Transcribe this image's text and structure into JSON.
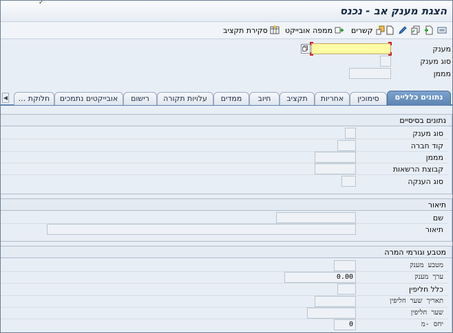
{
  "window": {
    "title": "הצגת מענק אב  - נכנס"
  },
  "toolbar": {
    "budget_closure": "סקירת תקציב",
    "object_map": "ממפה אובייקט",
    "relations": "קשרים"
  },
  "header": {
    "grant_label": "מענק",
    "grant_value": "",
    "grant_type_label": "סוג מענק",
    "grant_type_value": "",
    "sponsor_label": "מממן",
    "sponsor_value": ""
  },
  "tabs": [
    {
      "label": "נתונים כלליים",
      "active": true
    },
    {
      "label": "סימוכין",
      "active": false
    },
    {
      "label": "אחריות",
      "active": false
    },
    {
      "label": "תקציב",
      "active": false
    },
    {
      "label": "חיוב",
      "active": false
    },
    {
      "label": "ממדים",
      "active": false
    },
    {
      "label": "עלויות תקורה",
      "active": false
    },
    {
      "label": "רישום",
      "active": false
    },
    {
      "label": "אובייקטים נתמכים",
      "active": false
    },
    {
      "label": "חלוקת ...",
      "active": false
    }
  ],
  "basic_data": {
    "title": "נתונים בסיסיים",
    "grant_type_label": "סוג מענק",
    "grant_type_value": "",
    "company_code_label": "קוד חברה",
    "company_code_value": "",
    "sponsor_label": "מממן",
    "sponsor_value": "",
    "auth_group_label": "קבוצת הרשאות",
    "auth_group_value": "",
    "award_type_label": "סוג הענקה",
    "award_type_value": ""
  },
  "description": {
    "title": "תיאור",
    "name_label": "שם",
    "name_value": "",
    "desc_label": "תיאור",
    "desc_value": ""
  },
  "currency": {
    "title": "מטבע וגורמי המרה",
    "grant_currency_label": "מטבע מענק",
    "grant_currency_value": "",
    "grant_value_label": "ערך מענק",
    "grant_value_value": "0.00",
    "exchange_rule_label": "כלל חליפין",
    "exchange_rule_value": "",
    "exchange_date_label": "תאריך שער חליפין",
    "exchange_date_value": "",
    "exchange_rate_label": "שער חליפין",
    "exchange_rate_value": "",
    "ratio_label": "יחס -מ",
    "ratio_value": "0"
  },
  "colors": {
    "active_tab": "#5c83b0",
    "required_field": "#fffca3",
    "background": "#e8eef5"
  }
}
